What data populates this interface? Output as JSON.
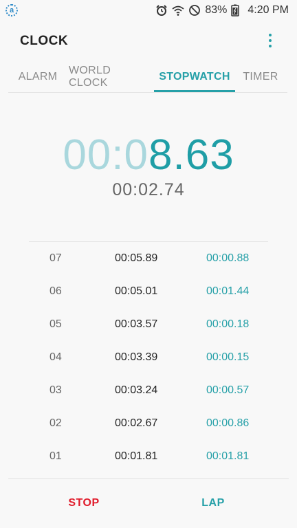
{
  "status_bar": {
    "battery": "83%",
    "time": "4:20 PM"
  },
  "app": {
    "title": "CLOCK"
  },
  "tabs": [
    {
      "label": "ALARM"
    },
    {
      "label": "WORLD CLOCK"
    },
    {
      "label": "STOPWATCH",
      "active": true
    },
    {
      "label": "TIMER"
    }
  ],
  "stopwatch": {
    "main_dim": "00:0",
    "main_bright": "8.63",
    "lap_time": "00:02.74"
  },
  "laps": [
    {
      "num": "07",
      "total": "00:05.89",
      "split": "00:00.88"
    },
    {
      "num": "06",
      "total": "00:05.01",
      "split": "00:01.44"
    },
    {
      "num": "05",
      "total": "00:03.57",
      "split": "00:00.18"
    },
    {
      "num": "04",
      "total": "00:03.39",
      "split": "00:00.15"
    },
    {
      "num": "03",
      "total": "00:03.24",
      "split": "00:00.57"
    },
    {
      "num": "02",
      "total": "00:02.67",
      "split": "00:00.86"
    },
    {
      "num": "01",
      "total": "00:01.81",
      "split": "00:01.81"
    }
  ],
  "buttons": {
    "stop": "STOP",
    "lap": "LAP"
  },
  "colors": {
    "accent": "#26a0a8",
    "stop": "#e01a2a"
  }
}
